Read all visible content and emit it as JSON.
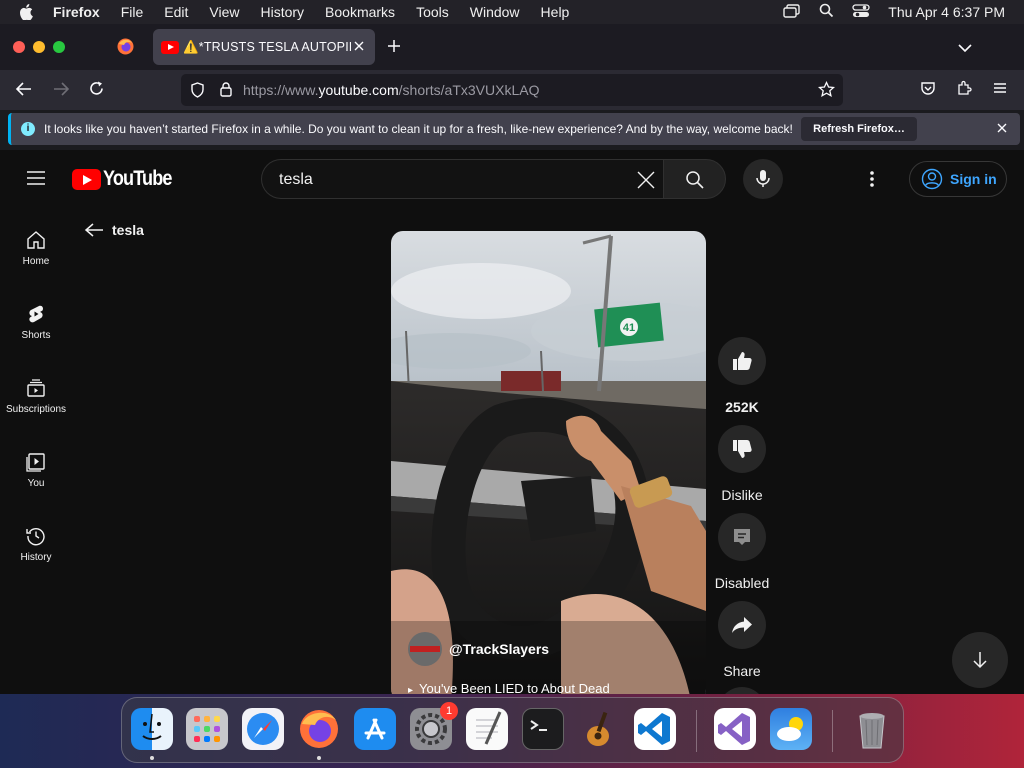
{
  "menubar": {
    "app_name": "Firefox",
    "menus": [
      "File",
      "Edit",
      "View",
      "History",
      "Bookmarks",
      "Tools",
      "Window",
      "Help"
    ],
    "clock": "Thu Apr 4  6:37 PM"
  },
  "browser": {
    "tab_title": "⚠️*TRUSTS TESLA AUTOPILOT",
    "url_prefix": "https://www.",
    "url_domain": "youtube.com",
    "url_path": "/shorts/aTx3VUXkLAQ"
  },
  "notification": {
    "message": "It looks like you haven’t started Firefox in a while. Do you want to clean it up for a fresh, like-new experience? And by the way, welcome back!",
    "button": "Refresh Firefox…"
  },
  "youtube": {
    "logo_text": "YouTube",
    "search_query": "tesla",
    "sign_in": "Sign in",
    "guide": [
      {
        "label": "Home",
        "icon": "home-icon"
      },
      {
        "label": "Shorts",
        "icon": "shorts-icon"
      },
      {
        "label": "Subscriptions",
        "icon": "subscriptions-icon"
      },
      {
        "label": "You",
        "icon": "you-icon"
      },
      {
        "label": "History",
        "icon": "history-icon"
      }
    ],
    "back_label": "tesla",
    "short": {
      "channel": "@TrackSlayers",
      "title": "You've Been LIED to About Dead",
      "sign_number": "41"
    },
    "actions": {
      "like_count": "252K",
      "dislike": "Dislike",
      "comments": "Disabled",
      "share": "Share"
    }
  },
  "dock": {
    "apps": [
      "Finder",
      "Launchpad",
      "Safari",
      "Firefox",
      "App Store",
      "System Settings",
      "TextEdit",
      "Terminal",
      "GarageBand",
      "Visual Studio Code",
      "Visual Studio",
      "Weather",
      "Trash"
    ],
    "settings_badge": "1"
  }
}
